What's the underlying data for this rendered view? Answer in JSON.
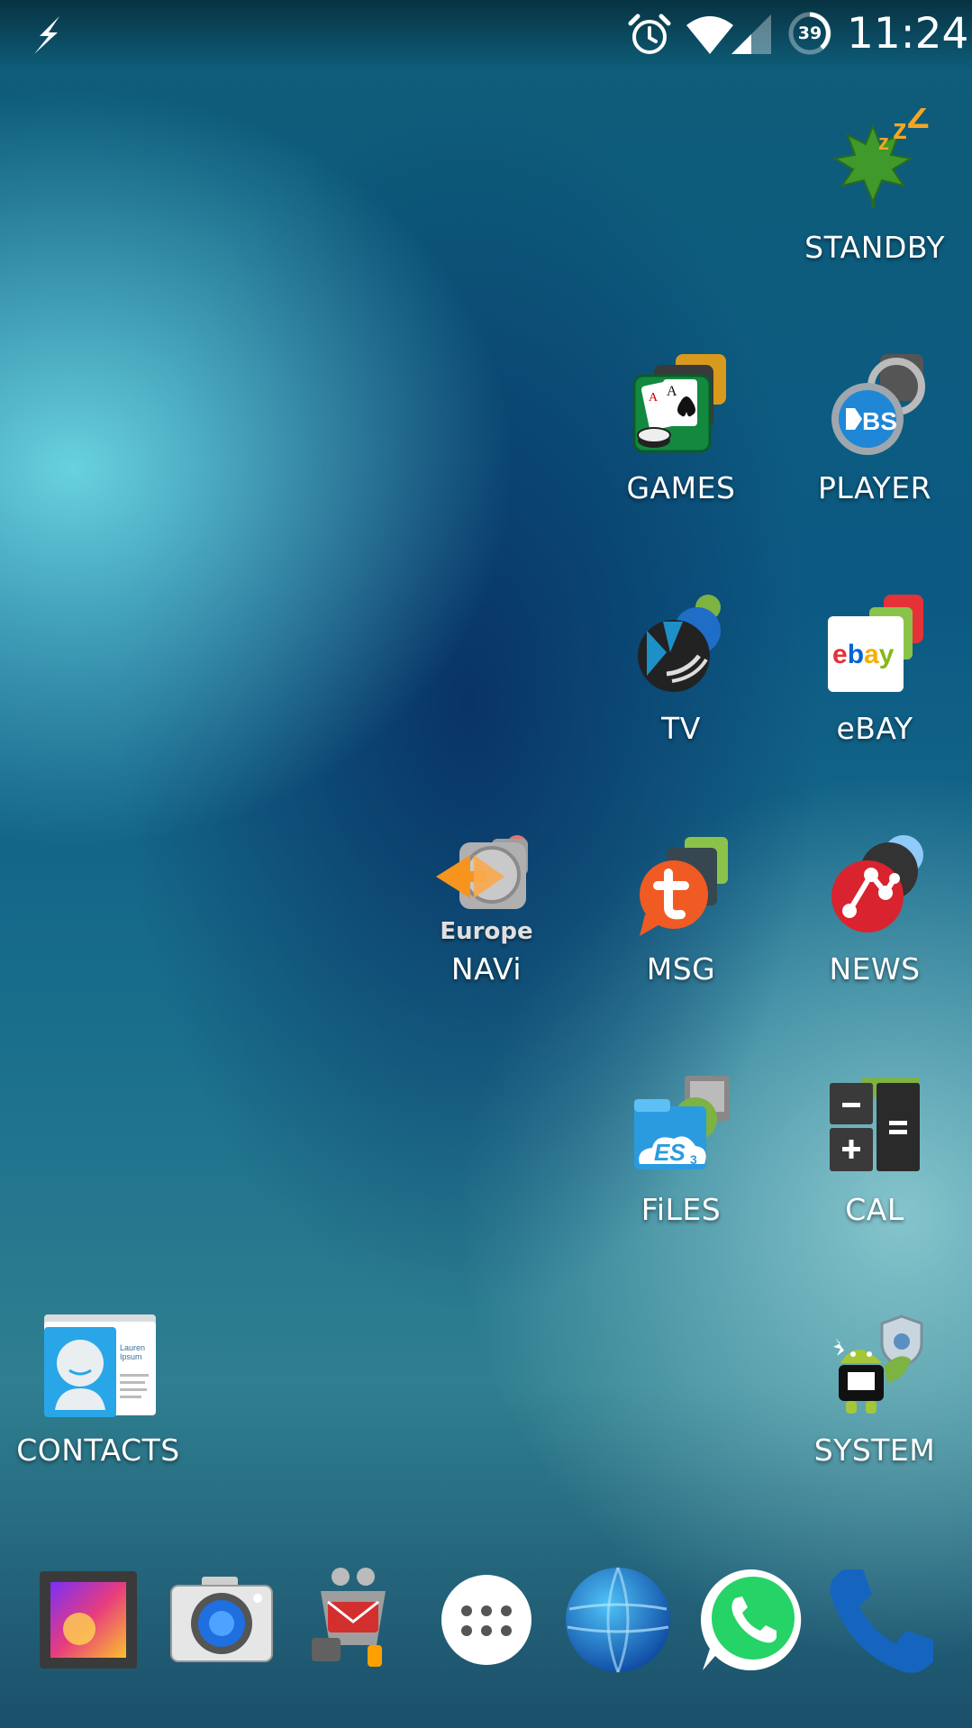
{
  "status_bar": {
    "time": "11:24",
    "battery_level": "39",
    "icons": [
      "flash-icon",
      "alarm-icon",
      "wifi-icon",
      "signal-icon",
      "battery-icon"
    ]
  },
  "home_apps": [
    {
      "label": "STANDBY",
      "icon": "standby-leaf-icon"
    },
    {
      "label": "GAMES",
      "icon": "games-cards-icon"
    },
    {
      "label": "PLAYER",
      "icon": "bsplayer-icon"
    },
    {
      "label": "TV",
      "icon": "tv-kodi-icon"
    },
    {
      "label": "eBAY",
      "icon": "ebay-icon"
    },
    {
      "label": "NAVi",
      "icon": "navi-europe-icon"
    },
    {
      "label": "MSG",
      "icon": "msg-tapatalk-icon"
    },
    {
      "label": "NEWS",
      "icon": "news-icon"
    },
    {
      "label": "FiLES",
      "icon": "files-es-icon"
    },
    {
      "label": "CAL",
      "icon": "calculator-icon"
    },
    {
      "label": "CONTACTS",
      "icon": "contacts-icon"
    },
    {
      "label": "SYSTEM",
      "icon": "system-android-icon"
    }
  ],
  "contact_card": {
    "name_line1": "Lauren",
    "name_line2": "Ipsum"
  },
  "navi_subtitle": "Europe",
  "ebay_logo_text": "ebay",
  "dock": [
    "gallery-icon",
    "camera-icon",
    "mail-robot-icon",
    "app-drawer-icon",
    "browser-globe-icon",
    "whatsapp-icon",
    "phone-icon"
  ],
  "colors": {
    "ebay_red": "#e53238",
    "ebay_blue": "#0064d2",
    "ebay_yellow": "#f5af02",
    "ebay_green": "#86b817",
    "tapatalk_orange": "#f05a23",
    "news_red": "#d9232e",
    "whatsapp_green": "#25d366",
    "phone_blue": "#1565c0"
  }
}
